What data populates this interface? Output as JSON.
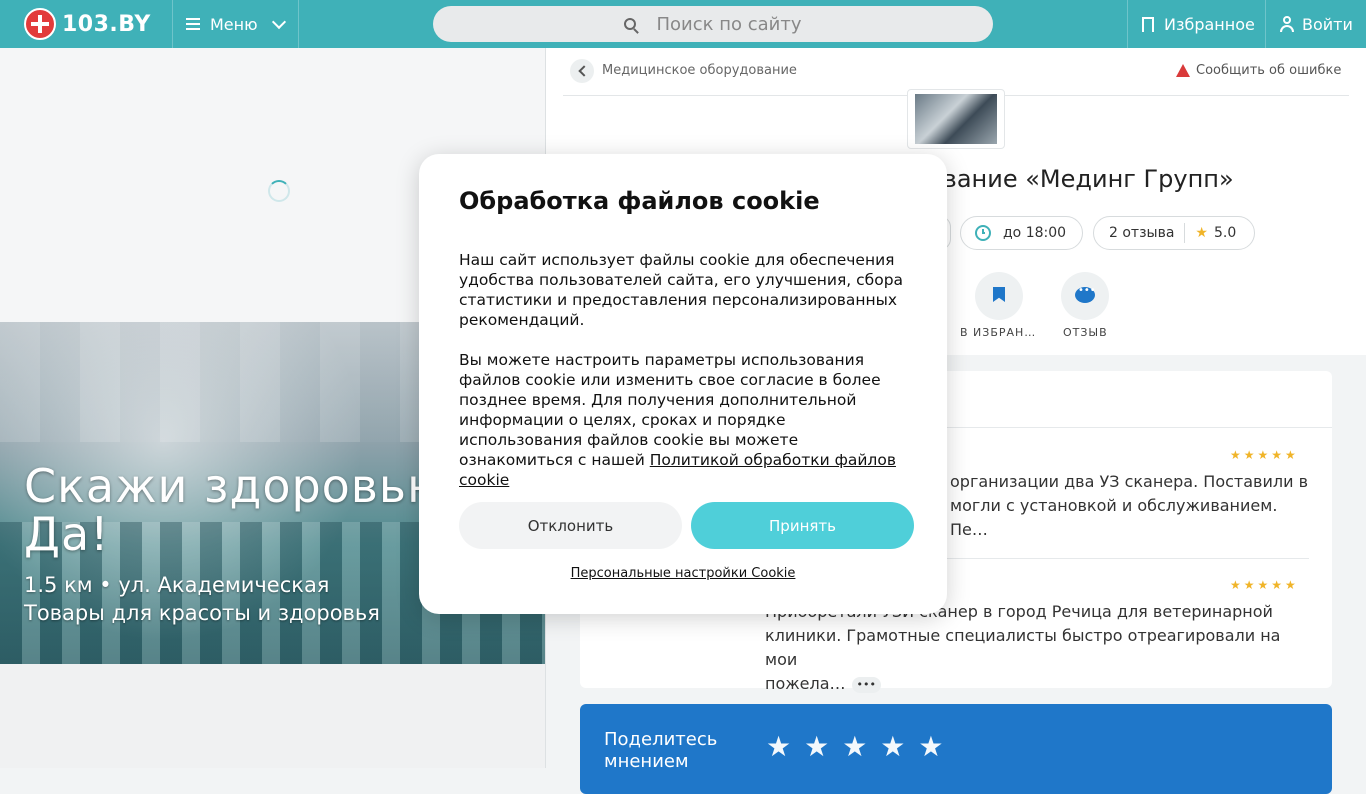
{
  "header": {
    "logo_text": "103.BY",
    "menu_label": "Меню",
    "search_placeholder": "Поиск по сайту",
    "favorites_label": "Избранное",
    "login_label": "Войти"
  },
  "banner": {
    "title": "Скажи здоровью Да!",
    "distance_address": "1.5 км • ул. Академическая",
    "category": "Товары для красоты и здоровья"
  },
  "company": {
    "breadcrumb": "Медицинское оборудование",
    "report_error": "Сообщить об ошибке",
    "title_visible": "ование «Мединг Групп»",
    "hours": "до 18:00",
    "reviews_count": "2 отзыва",
    "rating": "5.0",
    "actions": {
      "favorite": "В ИЗБРАН…",
      "review": "ОТЗЫВ"
    }
  },
  "reviews": [
    {
      "stars": "★★★★★",
      "text": "организации два УЗ сканера. Поставили в",
      "text2": "могли с установкой и обслуживанием. Пе…"
    },
    {
      "stars": "★★★★★",
      "text": "Приобретали УЗИ сканер в город Речица для ветеринарной",
      "text2": "клиники. Грамотные специалисты быстро отреагировали на мои",
      "text3": "пожела…",
      "more": "•••"
    }
  ],
  "share": {
    "label": "Поделитесь мнением",
    "stars": "★★★★★"
  },
  "cookie_modal": {
    "title": "Обработка файлов cookie",
    "paragraph1": "Наш сайт использует файлы cookie для обеспечения удобства пользователей сайта, его улучшения, сбора статистики и предоставления персонализированных рекомендаций.",
    "paragraph2": "Вы можете настроить параметры использования файлов cookie или изменить свое согласие в более позднее время. Для получения дополнительной информации о целях, сроках и порядке использования файлов cookie вы можете ознакомиться с нашей",
    "policy_link": "Политикой обработки файлов cookie",
    "decline_label": "Отклонить",
    "accept_label": "Принять",
    "settings_link": "Персональные настройки Cookie"
  },
  "colors": {
    "header_bg": "#3fb1b8",
    "accept_button": "#4fcfd9",
    "share_card": "#1f77c9",
    "star": "#f0b429"
  }
}
